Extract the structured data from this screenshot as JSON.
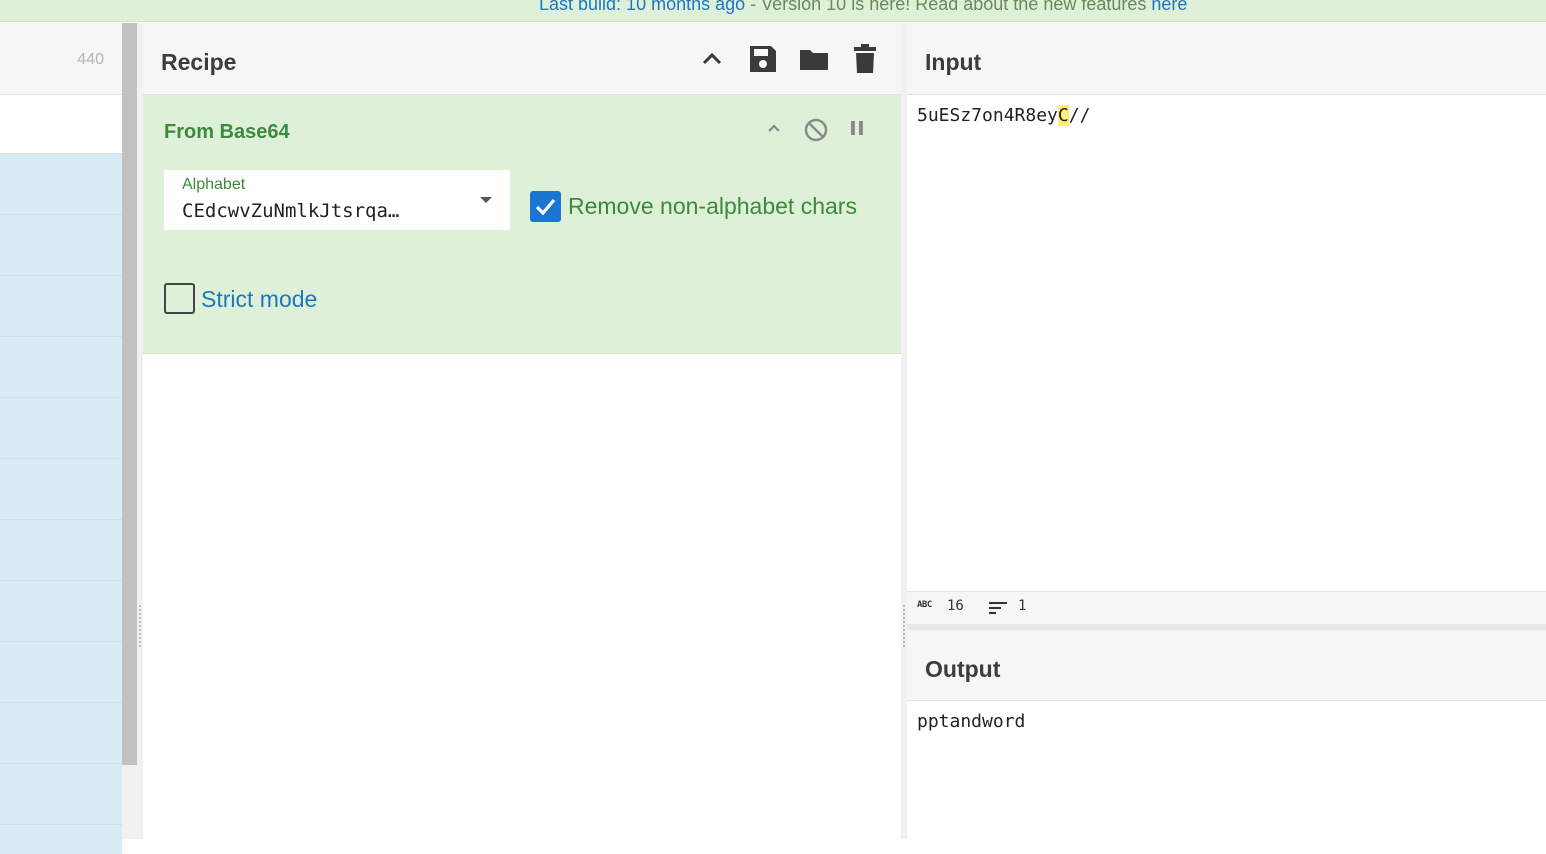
{
  "banner": {
    "prefix_link": "Last build: 10 months ago",
    "middle": " - Version 10 is here! Read about the new features ",
    "suffix_link": "here"
  },
  "operations": {
    "count": "440"
  },
  "recipe": {
    "title": "Recipe",
    "icons": [
      "chevron-up-icon",
      "save-icon",
      "folder-icon",
      "trash-icon"
    ],
    "operation": {
      "name": "From Base64",
      "alphabet_label": "Alphabet",
      "alphabet_value": "CEdcwvZuNmlkJtsrqa…",
      "remove_non_alphabet_label": "Remove non-alphabet chars",
      "remove_non_alphabet_checked": true,
      "strict_mode_label": "Strict mode",
      "strict_mode_checked": false
    }
  },
  "input": {
    "title": "Input",
    "text_before": "5uESz7on4R8ey",
    "text_highlight": "C",
    "text_after": "//",
    "char_count_label": "ABC",
    "char_count": "16",
    "line_count": "1"
  },
  "output": {
    "title": "Output",
    "text": "pptandword"
  },
  "colors": {
    "accent_green": "#3b8a3e",
    "card_bg": "#dff0d8",
    "link_blue": "#1f76c2",
    "checkbox_blue": "#1976d2"
  }
}
